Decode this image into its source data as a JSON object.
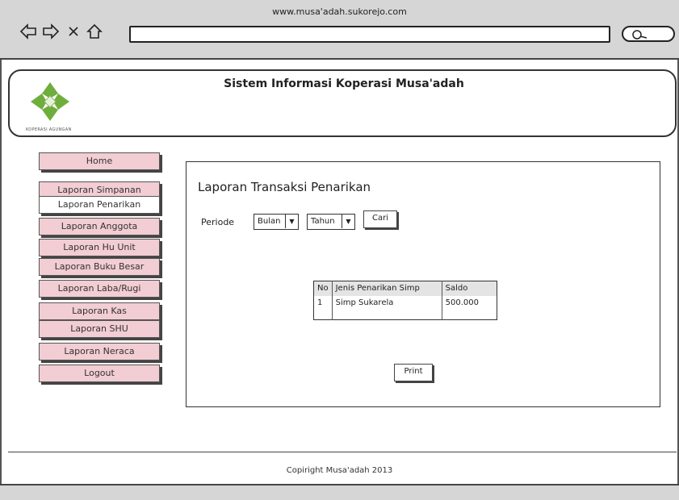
{
  "browser": {
    "url": "www.musa'adah.sukorejo.com",
    "icons": [
      "back-arrow-icon",
      "forward-arrow-icon",
      "close-icon",
      "home-icon",
      "search-icon"
    ]
  },
  "header": {
    "title": "Sistem Informasi Koperasi Musa'adah",
    "logo_caption": "KOPERASI AGUNGAN"
  },
  "sidebar": {
    "items": [
      {
        "label": "Home"
      },
      {
        "label": "Laporan Simpanan"
      },
      {
        "label": "Laporan Penarikan",
        "active": true
      },
      {
        "label": "Laporan Anggota"
      },
      {
        "label": "Laporan Hu Unit"
      },
      {
        "label": "Laporan Buku Besar"
      },
      {
        "label": "Laporan Laba/Rugi"
      },
      {
        "label": "Laporan Kas"
      },
      {
        "label": "Laporan SHU"
      },
      {
        "label": "Laporan Neraca"
      },
      {
        "label": "Logout"
      }
    ]
  },
  "main": {
    "title": "Laporan Transaksi Penarikan",
    "filter": {
      "periode_label": "Periode",
      "bulan_value": "Bulan",
      "tahun_value": "Tahun",
      "cari_label": "Cari"
    },
    "table": {
      "columns": [
        "No",
        "Jenis Penarikan Simp",
        "Saldo"
      ],
      "rows": [
        [
          "1",
          "Simp Sukarela",
          "500.000"
        ]
      ]
    },
    "print_label": "Print"
  },
  "footer": {
    "text": "Copiright Musa'adah 2013"
  },
  "colors": {
    "menu_bg": "#f2cdd3",
    "chrome_bg": "#d6d6d6",
    "logo_green": "#6fae3c"
  }
}
